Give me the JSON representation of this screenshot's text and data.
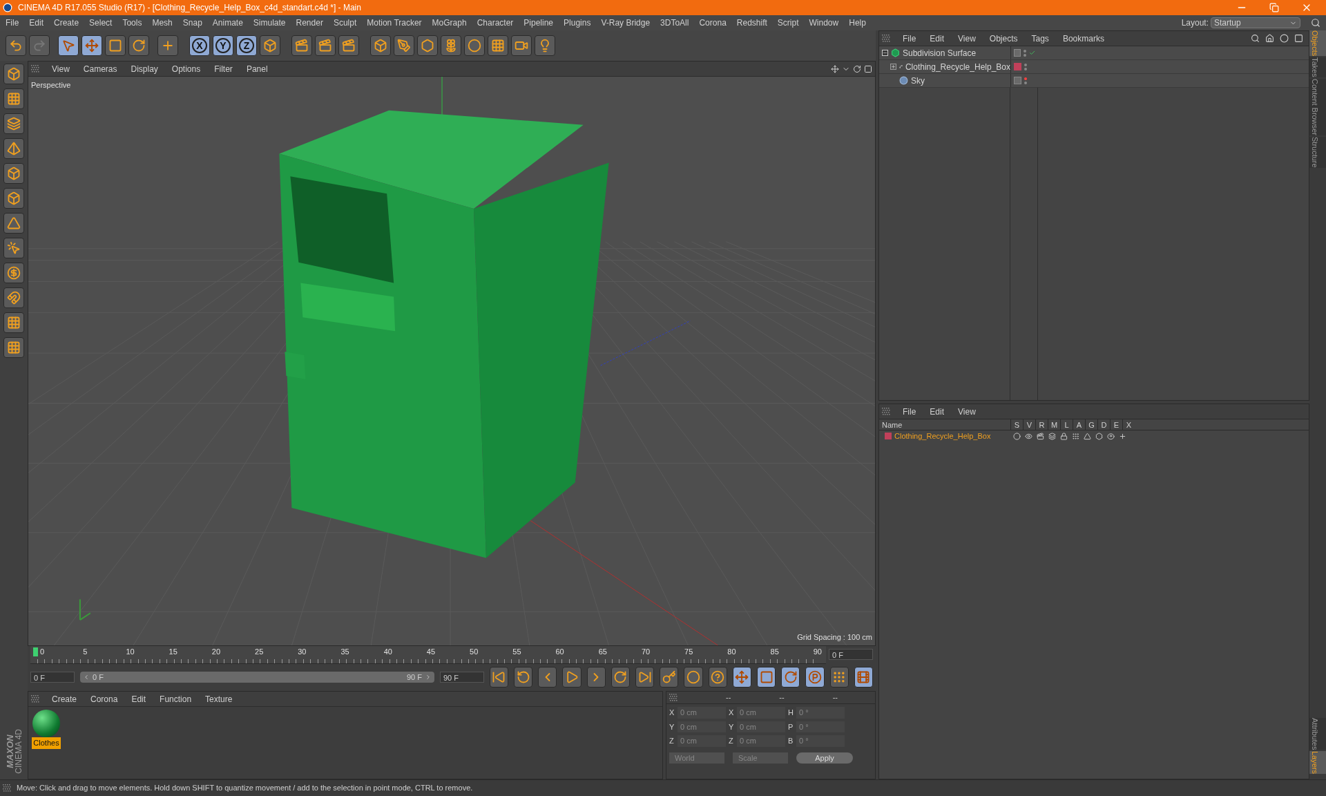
{
  "window": {
    "title": "CINEMA 4D R17.055 Studio (R17) - [Clothing_Recycle_Help_Box_c4d_standart.c4d *] - Main"
  },
  "menu": [
    "File",
    "Edit",
    "Create",
    "Select",
    "Tools",
    "Mesh",
    "Snap",
    "Animate",
    "Simulate",
    "Render",
    "Sculpt",
    "Motion Tracker",
    "MoGraph",
    "Character",
    "Pipeline",
    "Plugins",
    "V-Ray Bridge",
    "3DToAll",
    "Corona",
    "Redshift",
    "Script",
    "Window",
    "Help"
  ],
  "layout": {
    "label": "Layout:",
    "value": "Startup"
  },
  "toolbar": {
    "tools": [
      {
        "selected": false,
        "disabled": false
      },
      {
        "selected": false,
        "disabled": true
      },
      {
        "selected": true,
        "disabled": false
      },
      {
        "selected": true,
        "disabled": false
      },
      {
        "selected": false,
        "disabled": false
      },
      {
        "selected": false,
        "disabled": false
      },
      {
        "selected": false,
        "disabled": false
      }
    ],
    "axes": [
      {
        "label": "X",
        "selected": true
      },
      {
        "label": "Y",
        "selected": true
      },
      {
        "label": "Z",
        "selected": true
      }
    ]
  },
  "viewport": {
    "menu": [
      "View",
      "Cameras",
      "Display",
      "Options",
      "Filter",
      "Panel"
    ],
    "camera": "Perspective",
    "grid_spacing": "Grid Spacing : 100 cm"
  },
  "timeline": {
    "ticks": [
      "0",
      "5",
      "10",
      "15",
      "20",
      "25",
      "30",
      "35",
      "40",
      "45",
      "50",
      "55",
      "60",
      "65",
      "70",
      "75",
      "80",
      "85",
      "90"
    ],
    "level": 0.0,
    "current": "0 F",
    "start": "0 F",
    "range": {
      "start": "0 F",
      "end": "90 F",
      "level": 1.0
    },
    "end": "90 F"
  },
  "materials": {
    "menu": [
      "Create",
      "Corona",
      "Edit",
      "Function",
      "Texture"
    ],
    "items": [
      {
        "name": "Clothes",
        "selected": true
      }
    ]
  },
  "coordinates": {
    "headers": [
      "--",
      "--",
      "--"
    ],
    "rows": [
      {
        "axis": "X",
        "pos": "0 cm",
        "axis2": "X",
        "size": "0 cm",
        "rot_axis": "H",
        "rot": "0 °"
      },
      {
        "axis": "Y",
        "pos": "0 cm",
        "axis2": "Y",
        "size": "0 cm",
        "rot_axis": "P",
        "rot": "0 °"
      },
      {
        "axis": "Z",
        "pos": "0 cm",
        "axis2": "Z",
        "size": "0 cm",
        "rot_axis": "B",
        "rot": "0 °"
      }
    ],
    "mode": "World",
    "scale": "Scale",
    "apply": "Apply"
  },
  "objects": {
    "menu": [
      "File",
      "Edit",
      "View",
      "Objects",
      "Tags",
      "Bookmarks"
    ],
    "tree": [
      {
        "name": "Subdivision Surface",
        "kind": "subdivision",
        "expanded": true,
        "enabled": true,
        "editor_visible": true,
        "children": [
          {
            "name": "Clothing_Recycle_Help_Box",
            "kind": "null",
            "expanded": false,
            "editor_visible": true,
            "color": "#c0405a"
          },
          {
            "name": "Sky",
            "kind": "sky",
            "editor_visible": false
          }
        ]
      }
    ]
  },
  "layers": {
    "menu": [
      "File",
      "Edit",
      "View"
    ],
    "columns": [
      "Name",
      "S",
      "V",
      "R",
      "M",
      "L",
      "A",
      "G",
      "D",
      "E",
      "X"
    ],
    "rows": [
      {
        "name": "Clothing_Recycle_Help_Box",
        "color": "#c0405a",
        "selected": true
      }
    ]
  },
  "side_tabs": {
    "top": [
      {
        "label": "Objects",
        "selected": true
      },
      {
        "label": "Takes",
        "selected": false
      },
      {
        "label": "Content Browser",
        "selected": false
      },
      {
        "label": "Structure",
        "selected": false
      }
    ],
    "bottom": [
      {
        "label": "Attributes",
        "selected": false
      },
      {
        "label": "Layers",
        "selected": true
      }
    ]
  },
  "brand": {
    "line1": "MAXON",
    "line2": "CINEMA 4D"
  },
  "status": "Move: Click and drag to move elements. Hold down SHIFT to quantize movement / add to the selection in point mode, CTRL to remove."
}
